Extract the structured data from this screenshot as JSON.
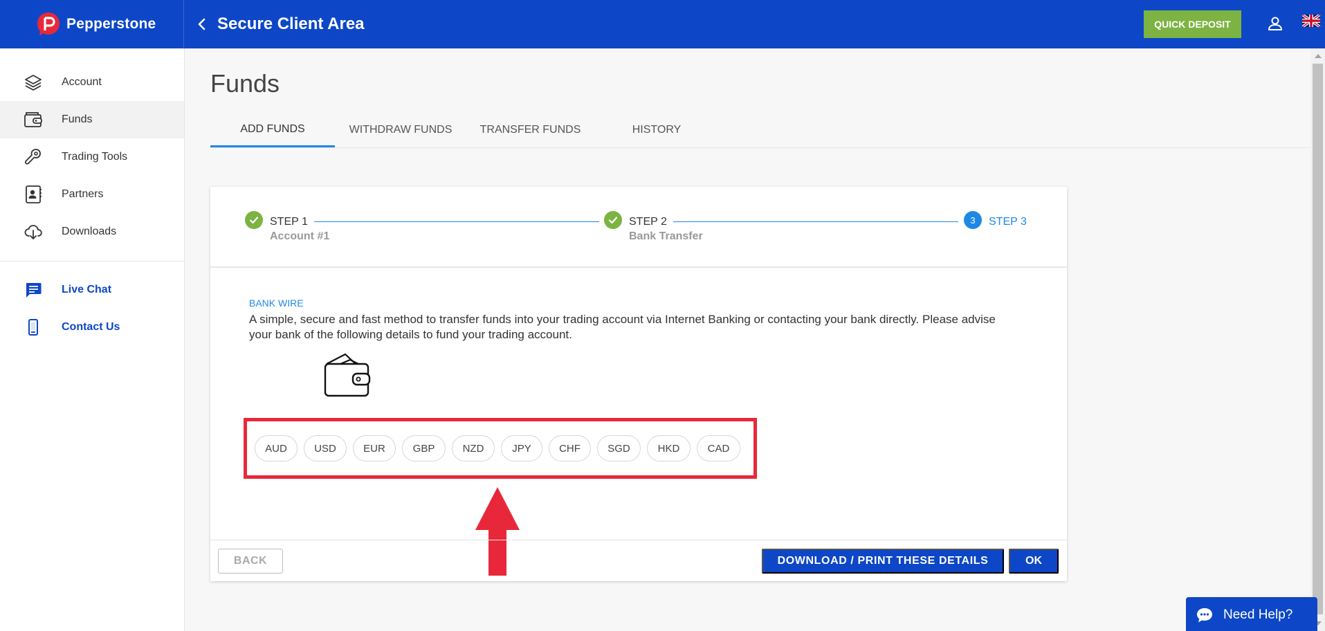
{
  "topbar": {
    "brand_name": "Pepperstone",
    "area_title": "Secure Client Area",
    "quick_deposit": "QUICK DEPOSIT"
  },
  "sidebar": {
    "items": [
      {
        "label": "Account",
        "icon": "layers-icon"
      },
      {
        "label": "Funds",
        "icon": "wallet-icon",
        "active": true
      },
      {
        "label": "Trading Tools",
        "icon": "wrench-icon"
      },
      {
        "label": "Partners",
        "icon": "contact-book-icon"
      },
      {
        "label": "Downloads",
        "icon": "cloud-download-icon"
      }
    ],
    "support": [
      {
        "label": "Live Chat",
        "icon": "chat-icon"
      },
      {
        "label": "Contact Us",
        "icon": "phone-icon"
      }
    ]
  },
  "page": {
    "title": "Funds",
    "tabs": [
      {
        "label": "ADD FUNDS",
        "active": true
      },
      {
        "label": "WITHDRAW FUNDS"
      },
      {
        "label": "TRANSFER FUNDS"
      },
      {
        "label": "HISTORY"
      }
    ]
  },
  "stepper": {
    "steps": [
      {
        "label": "STEP 1",
        "sub": "Account #1",
        "status": "complete"
      },
      {
        "label": "STEP 2",
        "sub": "Bank Transfer",
        "status": "complete"
      },
      {
        "label": "STEP 3",
        "number": "3",
        "status": "current"
      }
    ]
  },
  "bank_wire": {
    "section_label": "BANK WIRE",
    "description": "A simple, secure and fast method to transfer funds into your trading account via Internet Banking or contacting your bank directly. Please advise your bank of the following details to fund your trading account.",
    "currencies": [
      "AUD",
      "USD",
      "EUR",
      "GBP",
      "NZD",
      "JPY",
      "CHF",
      "SGD",
      "HKD",
      "CAD"
    ]
  },
  "actions": {
    "back": "BACK",
    "download": "DOWNLOAD / PRINT THESE DETAILS",
    "ok": "OK"
  },
  "help": {
    "label": "Need Help?"
  },
  "colors": {
    "brand_blue": "#0d47c7",
    "accent_blue": "#1e88e5",
    "success_green": "#7cb342",
    "annotation_red": "#e8283a"
  }
}
